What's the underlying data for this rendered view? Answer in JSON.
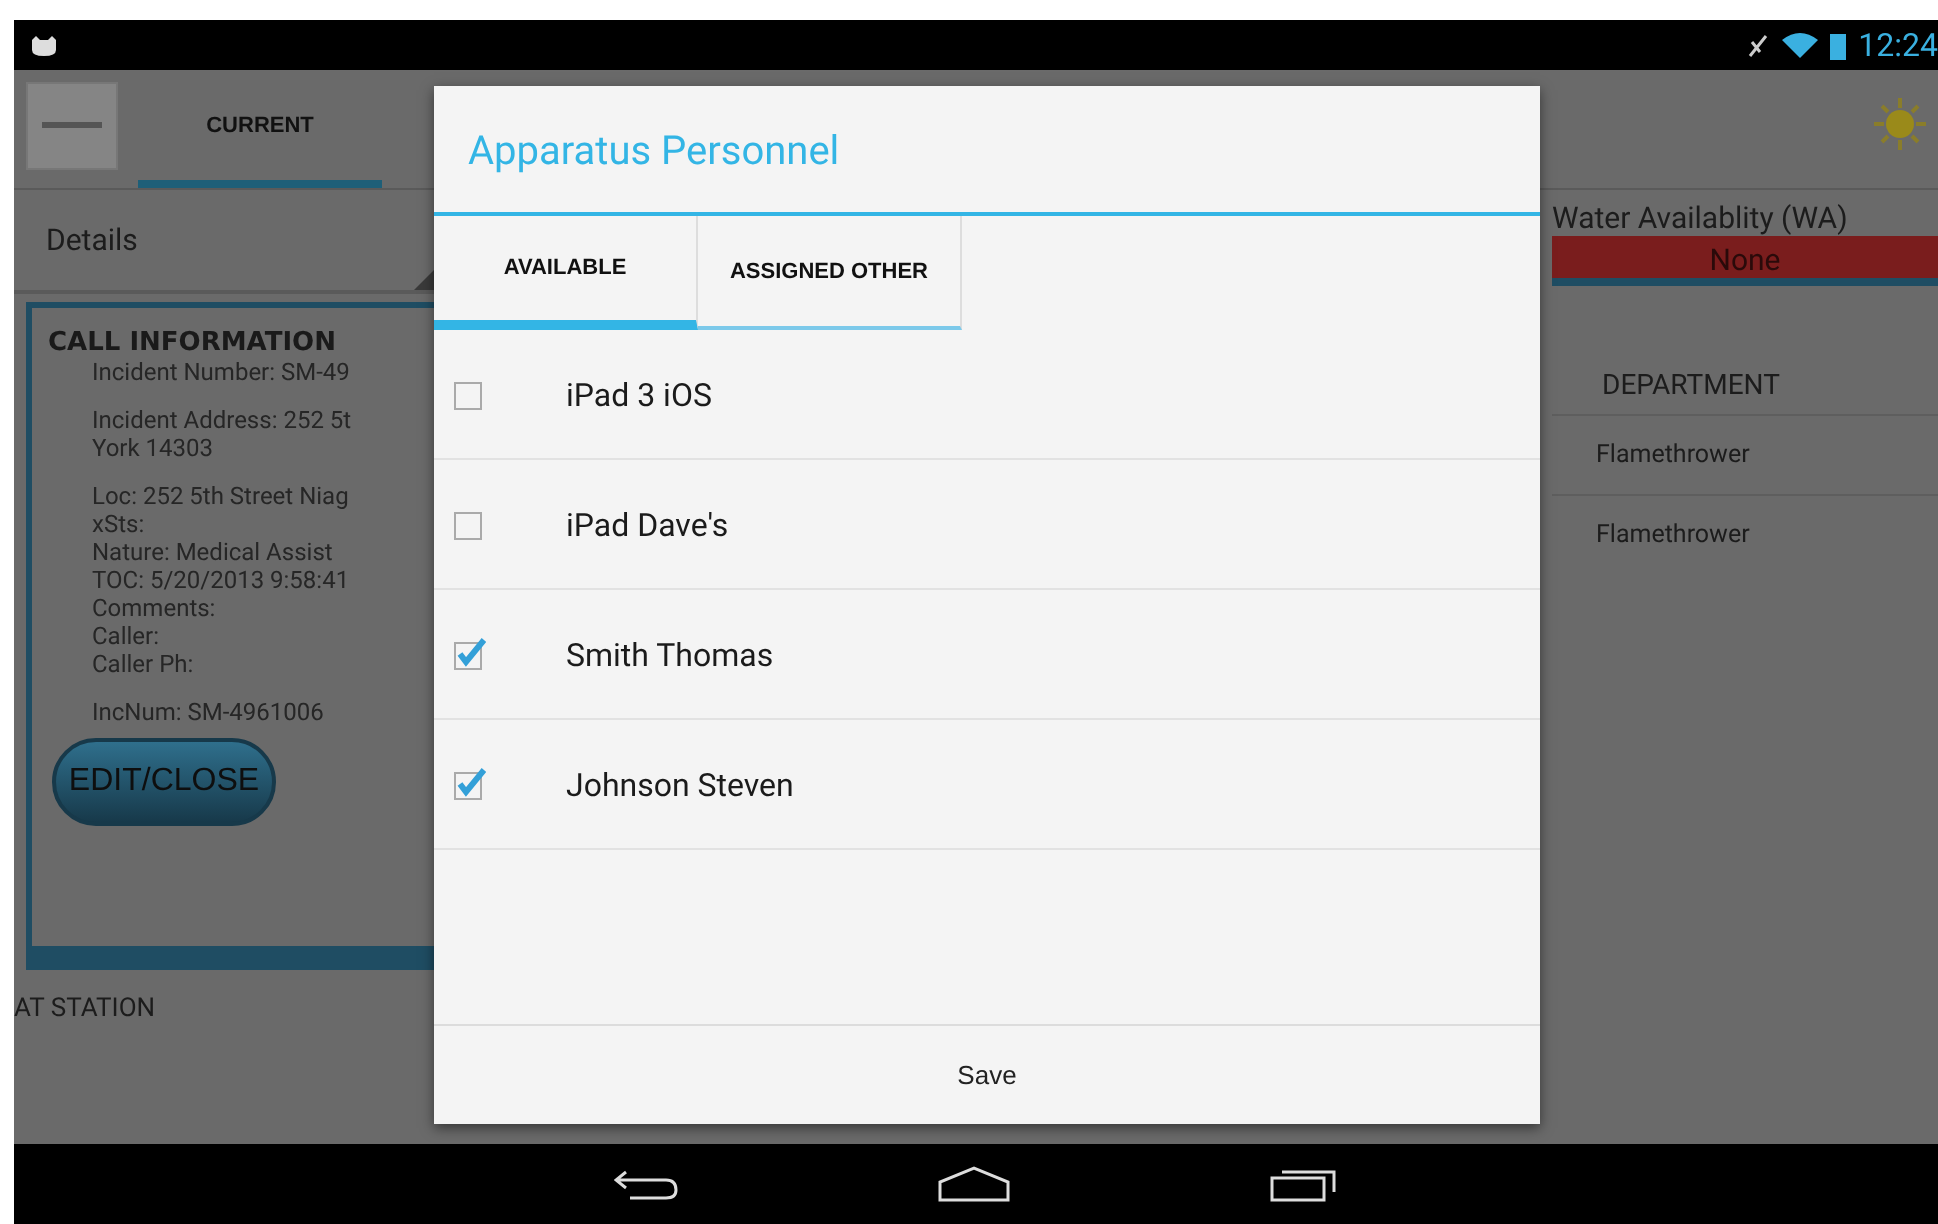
{
  "status_bar": {
    "time": "12:24"
  },
  "app": {
    "tabs": [
      {
        "label": "CURRENT",
        "selected": true
      }
    ],
    "details_dropdown": {
      "value": "Details"
    },
    "water": {
      "label": "Water Availablity (WA)",
      "value": "None"
    },
    "call_info": {
      "heading": "CALL INFORMATION",
      "blocks": [
        [
          "Incident Number: SM-49"
        ],
        [
          "Incident Address: 252 5t",
          "York 14303"
        ],
        [
          "Loc: 252 5th Street  Niag",
          "xSts:",
          "Nature: Medical Assist",
          "TOC: 5/20/2013 9:58:41",
          "Comments:",
          "Caller:",
          "Caller Ph:"
        ],
        [
          "IncNum: SM-4961006"
        ]
      ],
      "button": "EDIT/CLOSE"
    },
    "status_label": "AT STATION",
    "table": {
      "columns": [
        "DEPARTMENT"
      ],
      "rows": [
        [
          "Flamethrower"
        ],
        [
          "Flamethrower"
        ]
      ]
    }
  },
  "dialog": {
    "title": "Apparatus Personnel",
    "tabs": [
      {
        "label": "AVAILABLE",
        "selected": true
      },
      {
        "label": "ASSIGNED OTHER",
        "selected": false
      }
    ],
    "items": [
      {
        "name": "iPad 3 iOS",
        "checked": false
      },
      {
        "name": "iPad Dave's",
        "checked": false
      },
      {
        "name": "Smith Thomas",
        "checked": true
      },
      {
        "name": "Johnson Steven",
        "checked": true
      }
    ],
    "button": "Save"
  }
}
